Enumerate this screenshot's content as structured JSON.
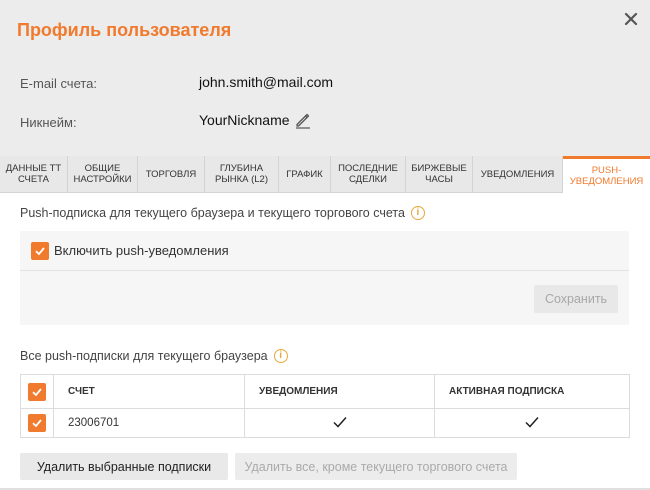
{
  "dialog": {
    "title": "Профиль пользователя",
    "close_icon": "close-icon"
  },
  "profile": {
    "email_label": "E-mail счета:",
    "email_value": "john.smith@mail.com",
    "nickname_label": "Никнейм:",
    "nickname_value": "YourNickname",
    "edit_icon": "pencil-icon"
  },
  "tabs": [
    {
      "label": "ДАННЫЕ ТТ СЧЕТА",
      "active": false
    },
    {
      "label": "ОБЩИЕ НАСТРОЙКИ",
      "active": false
    },
    {
      "label": "ТОРГОВЛЯ",
      "active": false
    },
    {
      "label": "ГЛУБИНА РЫНКА (L2)",
      "active": false
    },
    {
      "label": "ГРАФИК",
      "active": false
    },
    {
      "label": "ПОСЛЕДНИЕ СДЕЛКИ",
      "active": false
    },
    {
      "label": "БИРЖЕВЫЕ ЧАСЫ",
      "active": false
    },
    {
      "label": "УВЕДОМЛЕНИЯ",
      "active": false
    },
    {
      "label": "PUSH-УВЕДОМЛЕНИЯ",
      "active": true
    }
  ],
  "push_section": {
    "title": "Push-подписка для текущего браузера и текущего торгового счета",
    "enable_label": "Включить push-уведомления",
    "enable_checked": true,
    "save_label": "Сохранить"
  },
  "subs_section": {
    "title": "Все push-подписки для текущего браузера",
    "columns": [
      "СЧЕТ",
      "УВЕДОМЛЕНИЯ",
      "АКТИВНАЯ ПОДПИСКА"
    ],
    "rows": [
      {
        "account": "23006701",
        "notifications": true,
        "active": true,
        "checked": true
      }
    ],
    "delete_selected_label": "Удалить выбранные подписки",
    "delete_all_except_label": "Удалить все, кроме текущего торгового счета"
  },
  "colors": {
    "accent": "#f07a2d",
    "info": "#e8a93a",
    "header_bg": "#ececec"
  }
}
